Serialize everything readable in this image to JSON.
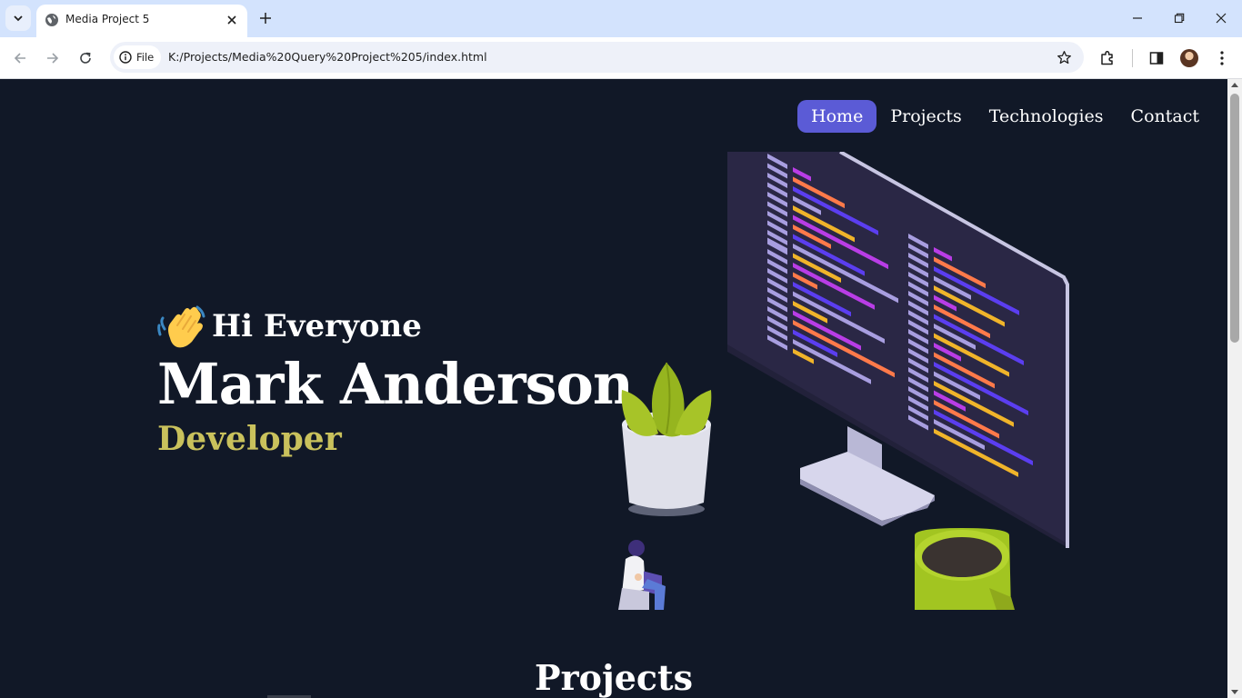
{
  "browser": {
    "tab_title": "Media Project 5",
    "chip_label": "File",
    "url": "K:/Projects/Media%20Query%20Project%205/index.html",
    "icons": [
      "tab-search-icon",
      "globe-icon",
      "close-icon",
      "plus-icon",
      "minimize-icon",
      "restore-icon",
      "back-arrow-icon",
      "forward-arrow-icon",
      "reload-icon",
      "info-icon",
      "star-icon",
      "extensions-icon",
      "side-panel-icon",
      "profile-avatar",
      "kebab-menu-icon"
    ]
  },
  "site": {
    "nav": [
      {
        "label": "Home",
        "active": true
      },
      {
        "label": "Projects",
        "active": false
      },
      {
        "label": "Technologies",
        "active": false
      },
      {
        "label": "Contact",
        "active": false
      }
    ],
    "hero": {
      "greeting_emoji": "waving-hand-icon",
      "greeting": "Hi Everyone",
      "name": "Mark Anderson",
      "role": "Developer"
    },
    "section_title": "Projects"
  },
  "colors": {
    "page_bg": "#111827",
    "nav_active_bg": "#5b5bd6",
    "role_color": "#c9c15c",
    "tabbar_bg": "#d3e3fd"
  }
}
